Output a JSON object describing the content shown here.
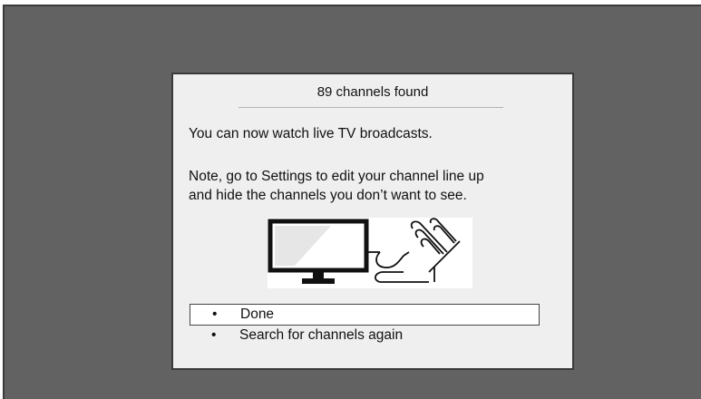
{
  "dialog": {
    "title": "89 channels found",
    "message1": "You can now watch live TV broadcasts.",
    "message2_line1": "Note, go to Settings to edit your channel line up",
    "message2_line2": "and hide the channels you don’t want to see.",
    "illustration": {
      "icons": [
        "tv-icon",
        "antenna-icon"
      ]
    },
    "options": [
      {
        "label": "Done",
        "selected": true
      },
      {
        "label": "Search for channels again",
        "selected": false
      }
    ]
  },
  "colors": {
    "background": "#626262",
    "dialog": "#efefef",
    "selection": "#ffffff"
  }
}
